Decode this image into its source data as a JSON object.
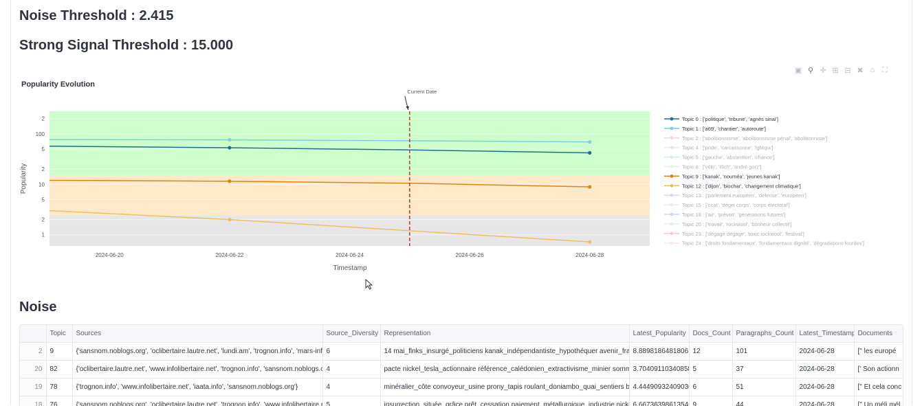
{
  "header": {
    "noise_threshold": "Noise Threshold : 2.415",
    "strong_threshold": "Strong Signal Threshold : 15.000"
  },
  "modebar": {
    "icons": [
      "camera-icon",
      "zoom-icon",
      "pan-icon",
      "zoom-in-icon",
      "zoom-out-icon",
      "autoscale-icon",
      "reset-axes-icon",
      "fullscreen-icon"
    ]
  },
  "chart_data": {
    "type": "line",
    "title": "Popularity Evolution",
    "xlabel": "Timestamp",
    "ylabel": "Popularity",
    "y_scale": "log",
    "y_tick_labels": [
      "1",
      "2",
      "5",
      "10",
      "2",
      "5",
      "100",
      "2"
    ],
    "y_tick_values": [
      1,
      2,
      5,
      10,
      20,
      50,
      100,
      200
    ],
    "x_tick_labels": [
      "2024-06-20",
      "2024-06-22",
      "2024-06-24",
      "2024-06-26",
      "2024-06-28"
    ],
    "xlim": [
      "2024-06-19",
      "2024-06-29"
    ],
    "ylim": [
      0.6,
      280
    ],
    "thresholds": {
      "noise": 2.415,
      "strong": 15.0
    },
    "zone_colors": {
      "strong": "#ccffcc",
      "weak": "#ffe9c8",
      "noise": "#e6e6e6"
    },
    "current_date": {
      "x": "2024-06-25",
      "label": "Current Date",
      "color": "#c0392b"
    },
    "series": [
      {
        "name": "Topic 0 : ['politique', 'tribune', 'agnès sinai']",
        "color": "#1f6f8b",
        "visible": true,
        "x": [
          "2024-06-19",
          "2024-06-22",
          "2024-06-25",
          "2024-06-28"
        ],
        "y": [
          57,
          53,
          48,
          42
        ]
      },
      {
        "name": "Topic 1 : ['a69', 'chantier', 'autoroute']",
        "color": "#7ecde0",
        "visible": true,
        "x": [
          "2024-06-19",
          "2024-06-22",
          "2024-06-25",
          "2024-06-28"
        ],
        "y": [
          77,
          76,
          73,
          69
        ]
      },
      {
        "name": "Topic 2 : ['abolitionnisme', 'abolitionnisme pénal', 'abolitionniste']",
        "color": "#e89aa8",
        "visible": false
      },
      {
        "name": "Topic 4 : ['pride', 'carcassonne', 'lgbtqia']",
        "color": "#f4b6c8",
        "visible": false
      },
      {
        "name": "Topic 5 : ['gauche', 'abstention', 'chance']",
        "color": "#8fd4c0",
        "visible": false
      },
      {
        "name": "Topic 6 : ['vélo', 'illich', 'andré gorz']",
        "color": "#b6e6b6",
        "visible": false
      },
      {
        "name": "Topic 9 : ['kanak', 'nouméa', 'jeunes kanak']",
        "color": "#e08214",
        "visible": true,
        "x": [
          "2024-06-19",
          "2024-06-22",
          "2024-06-25",
          "2024-06-28"
        ],
        "y": [
          12,
          11.5,
          10.5,
          8.9
        ]
      },
      {
        "name": "Topic 12 : ['dijon', 'biochar', 'changement climatique']",
        "color": "#f0c060",
        "visible": true,
        "x": [
          "2024-06-19",
          "2024-06-22",
          "2024-06-25",
          "2024-06-28"
        ],
        "y": [
          3,
          2,
          1.2,
          0.72
        ]
      },
      {
        "name": "Topic 13 : ['parlement européen', 'défense', 'européen']",
        "color": "#a79bd0",
        "visible": false
      },
      {
        "name": "Topic 15 : ['ccat', 'dégel corps', 'corps électoral']",
        "color": "#d0d4d8",
        "visible": false
      },
      {
        "name": "Topic 18 : ['air', 'prévoit', 'générations futures']",
        "color": "#6fa8dc",
        "visible": false
      },
      {
        "name": "Topic 20 : ['travail', 'rockwool', 'bonheur collectif']",
        "color": "#a8d8ea",
        "visible": false
      },
      {
        "name": "Topic 23 : ['dégage dégage', 'toxic rockwool', 'festival']",
        "color": "#f08080",
        "visible": false
      },
      {
        "name": "Topic 24 : ['droits fondamentaux', 'fondamentaux dignité', 'dégradations lourdes']",
        "color": "#f4c2d0",
        "visible": false
      }
    ]
  },
  "noise_section": {
    "title": "Noise",
    "columns": [
      "",
      "Topic",
      "Sources",
      "Source_Diversity",
      "Representation",
      "Latest_Popularity",
      "Docs_Count",
      "Paragraphs_Count",
      "Latest_Timestamp",
      "Documents"
    ],
    "rows": [
      [
        "2",
        "9",
        "{'sansnom.noblogs.org', 'oclibertaire.lautre.net', 'lundi.am', 'trognon.info', 'mars-info.",
        "6",
        "14 mai_flnks_insurgé_politiciens kanak_indépendantiste_hypothéquer avenir_franc",
        "8.889818648180613",
        "12",
        "101",
        "2024-06-28",
        "[\" les europé"
      ],
      [
        "20",
        "82",
        "{'oclibertaire.lautre.net', 'www.infolibertaire.net', 'trognon.info', 'sansnom.noblogs.o",
        "4",
        "pacte nickel_tesla_actionnaire référence_calédonien_extractivisme_minier somme_",
        "3.704091103408589",
        "5",
        "37",
        "2024-06-28",
        "[' Son actionn"
      ],
      [
        "19",
        "78",
        "{'trognon.info', 'www.infolibertaire.net', 'iaata.info', 'sansnom.noblogs.org'}",
        "4",
        "minéralier_côte convoyeur_usine prony_tapis roulant_doniambo_quai_sentiers batt",
        "4.444909324090307",
        "6",
        "51",
        "2024-06-28",
        "[\" Et cela conc"
      ],
      [
        "18",
        "76",
        "{'sansnom.noblogs.org', 'oclibertaire.lautre.net', 'trognon.info', 'www.infolibertaire.n",
        "5",
        "insurrection_située_grâce prêt_cessation paiement_métallurgique_industrie nickel",
        "6.667363986135461",
        "9",
        "44",
        "2024-06-28",
        "[\" Un méli mél"
      ]
    ]
  }
}
